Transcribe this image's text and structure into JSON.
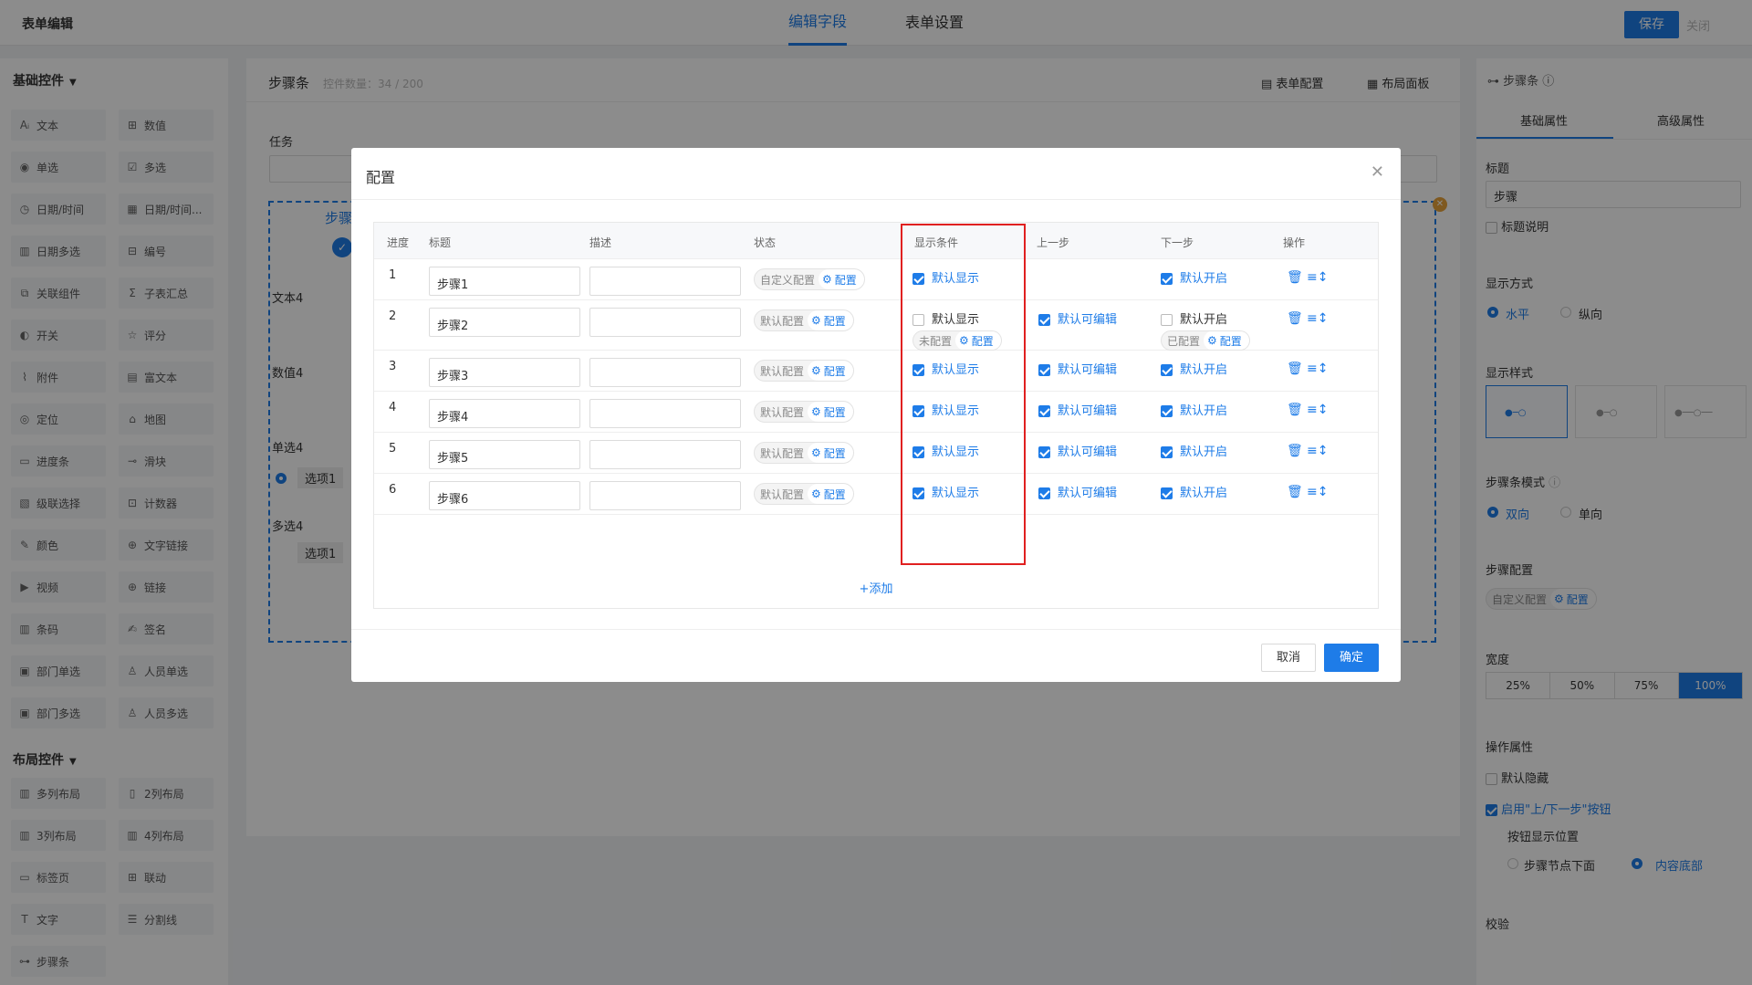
{
  "app_title": "表单编辑",
  "top_tabs": [
    "编辑字段",
    "表单设置"
  ],
  "save_label": "保存",
  "close_label": "关闭",
  "left": {
    "basic_title": "基础控件",
    "basic_controls": [
      {
        "label": "文本",
        "icon": "text-icon"
      },
      {
        "label": "数值",
        "icon": "number-icon"
      },
      {
        "label": "单选",
        "icon": "radio-icon"
      },
      {
        "label": "多选",
        "icon": "checkbox-icon"
      },
      {
        "label": "日期/时间",
        "icon": "clock-icon"
      },
      {
        "label": "日期/时间...",
        "icon": "calendar-icon"
      },
      {
        "label": "日期多选",
        "icon": "calendar-multi-icon"
      },
      {
        "label": "编号",
        "icon": "tag-icon"
      },
      {
        "label": "关联组件",
        "icon": "link-component-icon"
      },
      {
        "label": "子表汇总",
        "icon": "sigma-icon"
      },
      {
        "label": "开关",
        "icon": "toggle-icon"
      },
      {
        "label": "评分",
        "icon": "star-icon"
      },
      {
        "label": "附件",
        "icon": "paperclip-icon"
      },
      {
        "label": "富文本",
        "icon": "richtext-icon"
      },
      {
        "label": "定位",
        "icon": "location-icon"
      },
      {
        "label": "地图",
        "icon": "map-icon"
      },
      {
        "label": "进度条",
        "icon": "progress-icon"
      },
      {
        "label": "滑块",
        "icon": "slider-icon"
      },
      {
        "label": "级联选择",
        "icon": "cascade-icon"
      },
      {
        "label": "计数器",
        "icon": "counter-icon"
      },
      {
        "label": "颜色",
        "icon": "color-icon"
      },
      {
        "label": "文字链接",
        "icon": "globe-icon"
      },
      {
        "label": "视频",
        "icon": "video-icon"
      },
      {
        "label": "链接",
        "icon": "link-icon"
      },
      {
        "label": "条码",
        "icon": "barcode-icon"
      },
      {
        "label": "签名",
        "icon": "signature-icon"
      },
      {
        "label": "部门单选",
        "icon": "dept-icon"
      },
      {
        "label": "人员单选",
        "icon": "user-icon"
      },
      {
        "label": "部门多选",
        "icon": "dept-multi-icon"
      },
      {
        "label": "人员多选",
        "icon": "users-icon"
      }
    ],
    "layout_title": "布局控件",
    "layout_controls": [
      {
        "label": "多列布局",
        "icon": "columns-icon"
      },
      {
        "label": "2列布局",
        "icon": "columns-2-icon"
      },
      {
        "label": "3列布局",
        "icon": "columns-3-icon"
      },
      {
        "label": "4列布局",
        "icon": "columns-4-icon"
      },
      {
        "label": "标签页",
        "icon": "tabs-icon"
      },
      {
        "label": "联动",
        "icon": "linkage-icon"
      },
      {
        "label": "文字",
        "icon": "text-t-icon"
      },
      {
        "label": "分割线",
        "icon": "divider-icon"
      },
      {
        "label": "步骤条",
        "icon": "steps-icon"
      }
    ]
  },
  "canvas": {
    "title": "步骤条",
    "count": "控件数量：34 / 200",
    "form_config": "表单配置",
    "layout_panel": "布局面板",
    "fields": [
      "任务",
      "步骤",
      "文本4",
      "数值4",
      "单选4",
      "选项1",
      "多选4",
      "选项1"
    ]
  },
  "right": {
    "header": "步骤条",
    "tabs": [
      "基础属性",
      "高级属性"
    ],
    "title_label": "标题",
    "title_value": "步骤",
    "title_desc": "标题说明",
    "display_mode_label": "显示方式",
    "display_modes": [
      "水平",
      "纵向"
    ],
    "display_style_label": "显示样式",
    "step_mode_label": "步骤条模式",
    "step_modes": [
      "双向",
      "单向"
    ],
    "step_config_label": "步骤配置",
    "step_config_status": "自定义配置",
    "config_label": "配置",
    "width_label": "宽度",
    "widths": [
      "25%",
      "50%",
      "75%",
      "100%"
    ],
    "ops_label": "操作属性",
    "default_hidden": "默认隐藏",
    "enable_buttons": "启用\"上/下一步\"按钮",
    "btn_pos_label": "按钮显示位置",
    "btn_positions": [
      "步骤节点下面",
      "内容底部"
    ],
    "validate_label": "校验"
  },
  "modal": {
    "title": "配置",
    "headers": [
      "进度",
      "标题",
      "描述",
      "状态",
      "显示条件",
      "上一步",
      "下一步",
      "操作"
    ],
    "rows": [
      {
        "index": "1",
        "title": "步骤1",
        "desc": "",
        "status": "自定义配置",
        "show_checked": true,
        "show_label": "默认显示",
        "show_sub": "",
        "prev_checked": null,
        "prev_label": "",
        "next_checked": true,
        "next_label": "默认开启",
        "next_sub": ""
      },
      {
        "index": "2",
        "title": "步骤2",
        "desc": "",
        "status": "默认配置",
        "show_checked": false,
        "show_label": "默认显示",
        "show_sub": "未配置",
        "prev_checked": true,
        "prev_label": "默认可编辑",
        "next_checked": false,
        "next_label": "默认开启",
        "next_sub": "已配置"
      },
      {
        "index": "3",
        "title": "步骤3",
        "desc": "",
        "status": "默认配置",
        "show_checked": true,
        "show_label": "默认显示",
        "show_sub": "",
        "prev_checked": true,
        "prev_label": "默认可编辑",
        "next_checked": true,
        "next_label": "默认开启",
        "next_sub": ""
      },
      {
        "index": "4",
        "title": "步骤4",
        "desc": "",
        "status": "默认配置",
        "show_checked": true,
        "show_label": "默认显示",
        "show_sub": "",
        "prev_checked": true,
        "prev_label": "默认可编辑",
        "next_checked": true,
        "next_label": "默认开启",
        "next_sub": ""
      },
      {
        "index": "5",
        "title": "步骤5",
        "desc": "",
        "status": "默认配置",
        "show_checked": true,
        "show_label": "默认显示",
        "show_sub": "",
        "prev_checked": true,
        "prev_label": "默认可编辑",
        "next_checked": true,
        "next_label": "默认开启",
        "next_sub": ""
      },
      {
        "index": "6",
        "title": "步骤6",
        "desc": "",
        "status": "默认配置",
        "show_checked": true,
        "show_label": "默认显示",
        "show_sub": "",
        "prev_checked": true,
        "prev_label": "默认可编辑",
        "next_checked": true,
        "next_label": "默认开启",
        "next_sub": ""
      }
    ],
    "config_label": "配置",
    "add_label": "+添加",
    "cancel_label": "取消",
    "ok_label": "确定"
  },
  "colors": {
    "accent": "#1e7ce8",
    "highlight": "#e02020"
  }
}
